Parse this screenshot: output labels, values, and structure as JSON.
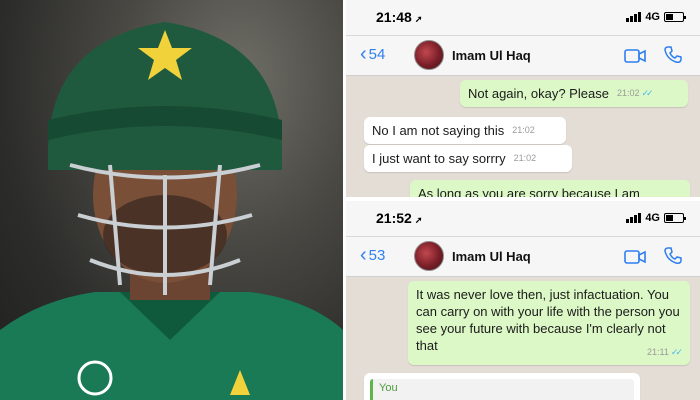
{
  "colors": {
    "jersey": "#1a7a55",
    "helmet": "#1f5a3e",
    "star": "#f2d23a",
    "chat_background": "#e4ddd6",
    "outgoing_bubble": "#dcf8c6",
    "incoming_bubble": "#ffffff",
    "link_blue": "#2f7ff0",
    "read_ticks": "#4fb6ec"
  },
  "screenshot_top": {
    "time": "21:48",
    "network": "4G",
    "back_count": "54",
    "contact_name": "Imam Ul Haq",
    "messages": [
      {
        "direction": "outgoing",
        "text": "Not again, okay? Please",
        "time": "21:02",
        "ticks": "✓✓"
      },
      {
        "direction": "incoming",
        "text": "No I am not saying this",
        "time": "21:02"
      },
      {
        "direction": "incoming",
        "text": "I just want to say sorrry",
        "time": "21:02"
      },
      {
        "direction": "outgoing",
        "text": "As long as you are sorry because I am"
      }
    ]
  },
  "screenshot_bottom": {
    "time": "21:52",
    "network": "4G",
    "back_count": "53",
    "contact_name": "Imam Ul Haq",
    "messages": [
      {
        "direction": "outgoing",
        "text": "It was never love then, just infactuation. You can carry on with your life with the person you see your future with because I'm clearly not that",
        "time": "21:11",
        "ticks": "✓✓"
      }
    ],
    "reply_preview_author": "You"
  }
}
